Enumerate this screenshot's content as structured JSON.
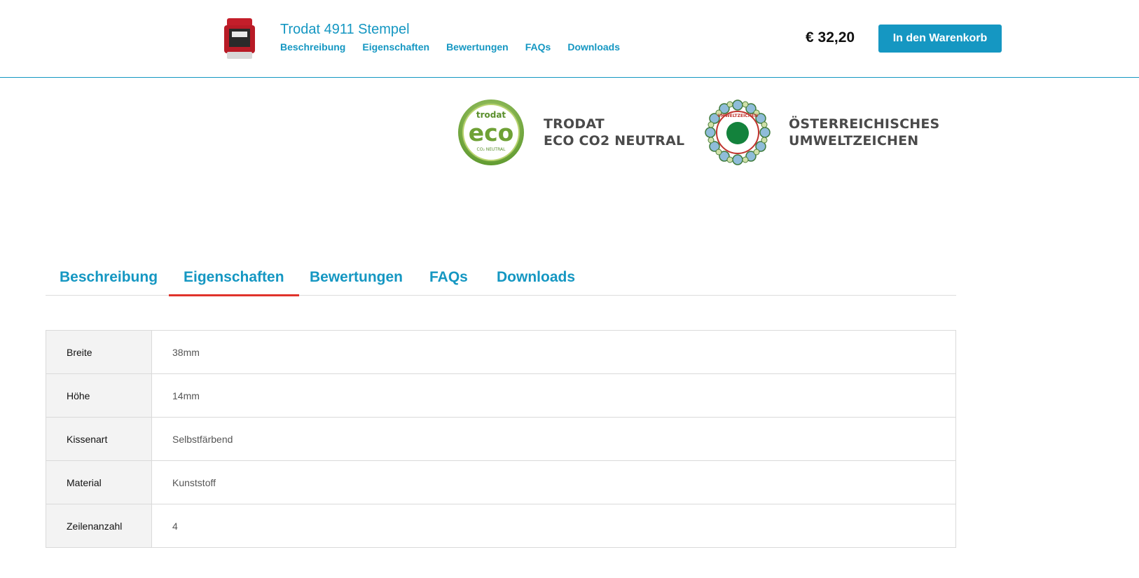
{
  "header": {
    "product_title": "Trodat 4911 Stempel",
    "nav": [
      "Beschreibung",
      "Eigenschaften",
      "Bewertungen",
      "FAQs",
      "Downloads"
    ],
    "price": "€ 32,20",
    "cart_button": "In den Warenkorb",
    "accent_color": "#1597c2"
  },
  "certifications": [
    {
      "logo_text_top": "trodat",
      "logo_text_main": "eco",
      "logo_text_bottom": "CO₂ NEUTRAL",
      "lines": [
        "TRODAT",
        "ECO CO2 NEUTRAL"
      ]
    },
    {
      "logo_text": "UMWELTZEICHEN",
      "lines": [
        "ÖSTERREICHISCHES",
        "UMWELTZEICHEN"
      ]
    }
  ],
  "tabs": {
    "items": [
      "Beschreibung",
      "Eigenschaften",
      "Bewertungen",
      "FAQs",
      "Downloads"
    ],
    "active": "Eigenschaften",
    "active_underline_color": "#e0332b"
  },
  "properties": [
    {
      "key": "Breite",
      "value": "38mm"
    },
    {
      "key": "Höhe",
      "value": "14mm"
    },
    {
      "key": "Kissenart",
      "value": "Selbstfärbend"
    },
    {
      "key": "Material",
      "value": "Kunststoff"
    },
    {
      "key": "Zeilenanzahl",
      "value": "4"
    }
  ]
}
